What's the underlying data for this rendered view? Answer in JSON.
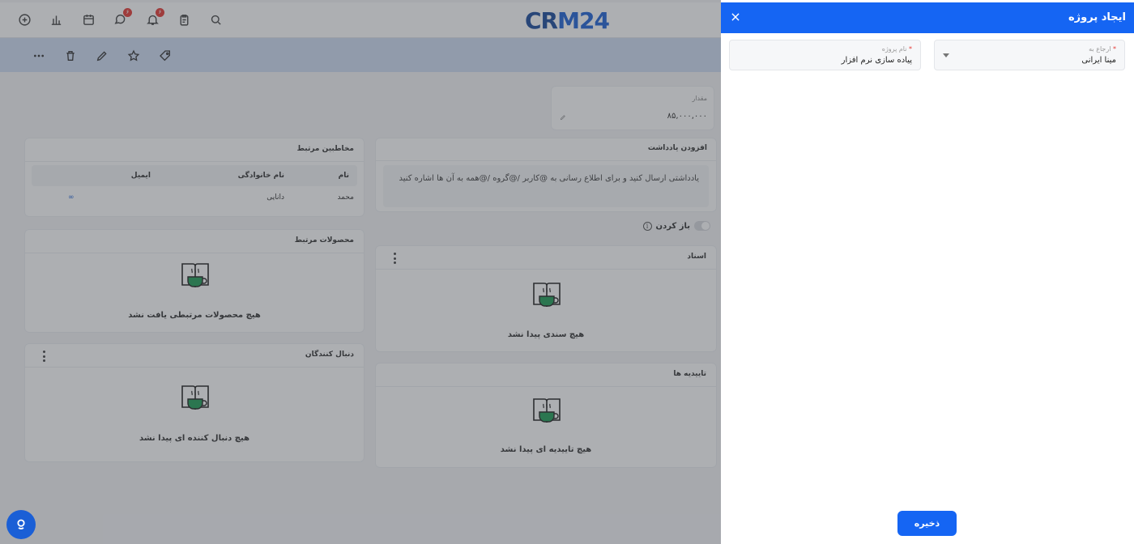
{
  "drawer": {
    "title": "ایجاد پروژه",
    "fields": {
      "related_to": {
        "label": "ارجاع به",
        "required_mark": "*",
        "value": "مینا ایرانی"
      },
      "project_name": {
        "label": "نام پروژه",
        "required_mark": "*",
        "value": "پیاده سازی نرم افزار"
      }
    },
    "save_label": "ذخیره"
  },
  "app": {
    "logo": {
      "part1": "CR",
      "part2": "M24"
    },
    "topbar": {
      "notifications_badge": "۶",
      "chat_badge": "۶"
    },
    "amount_card": {
      "label": "مقدار",
      "value": "۸۵,۰۰۰,۰۰۰"
    },
    "contacts_card": {
      "title": "مخاطبین مرتبط",
      "columns": [
        "نام",
        "نام خانوادگی",
        "ایمیل"
      ],
      "rows": [
        {
          "first": "محمد",
          "last": "دانایی",
          "email": "∞"
        }
      ]
    },
    "note_card": {
      "title": "افزودن یادداشت",
      "placeholder": "یادداشتی ارسال کنید و برای اطلاع رسانی به @کاربر /@گروه /@همه به آن ها اشاره کنید",
      "toggle_label": "باز کردن"
    },
    "products_card": {
      "title": "محصولات مرتبط",
      "empty": "هیچ محصولات مرتبطی یافت نشد"
    },
    "documents_card": {
      "title": "اسناد",
      "empty": "هیچ سندی پیدا نشد"
    },
    "followers_card": {
      "title": "دنبال کنندگان",
      "empty": "هیچ دنبال کننده ای پیدا نشد"
    },
    "approvals_card": {
      "title": "تاییدیه ها",
      "empty": "هیچ تاییدیه ای پیدا نشد"
    }
  },
  "colors": {
    "primary": "#1565f3",
    "overlay": "#3c4048",
    "empty_cup": "#1f9e57"
  }
}
